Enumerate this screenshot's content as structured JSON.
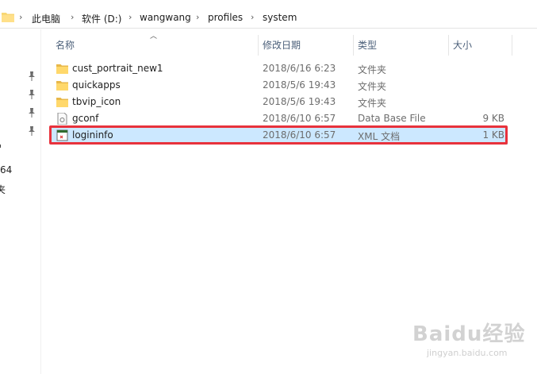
{
  "breadcrumb": {
    "items": [
      "此电脑",
      "软件 (D:)",
      "wangwang",
      "profiles",
      "system"
    ],
    "separator": "›"
  },
  "nav": {
    "partial_labels": [
      "64",
      "夹"
    ]
  },
  "columns": {
    "name": "名称",
    "date": "修改日期",
    "type": "类型",
    "size": "大小"
  },
  "files": [
    {
      "name": "cust_portrait_new1",
      "date": "2018/6/16 6:23",
      "type": "文件夹",
      "size": "",
      "icon": "folder-icon"
    },
    {
      "name": "quickapps",
      "date": "2018/5/6 19:43",
      "type": "文件夹",
      "size": "",
      "icon": "folder-icon"
    },
    {
      "name": "tbvip_icon",
      "date": "2018/5/6 19:43",
      "type": "文件夹",
      "size": "",
      "icon": "folder-icon"
    },
    {
      "name": "gconf",
      "date": "2018/6/10 6:57",
      "type": "Data Base File",
      "size": "9 KB",
      "icon": "file-icon"
    },
    {
      "name": "logininfo",
      "date": "2018/6/10 6:57",
      "type": "XML 文档",
      "size": "1 KB",
      "icon": "xml-file-icon"
    }
  ],
  "selected_index": 4,
  "highlight_color": "#e8323c",
  "selection_color": "#cce8ff",
  "watermark": {
    "main": "Baidu经验",
    "sub": "jingyan.baidu.com"
  }
}
